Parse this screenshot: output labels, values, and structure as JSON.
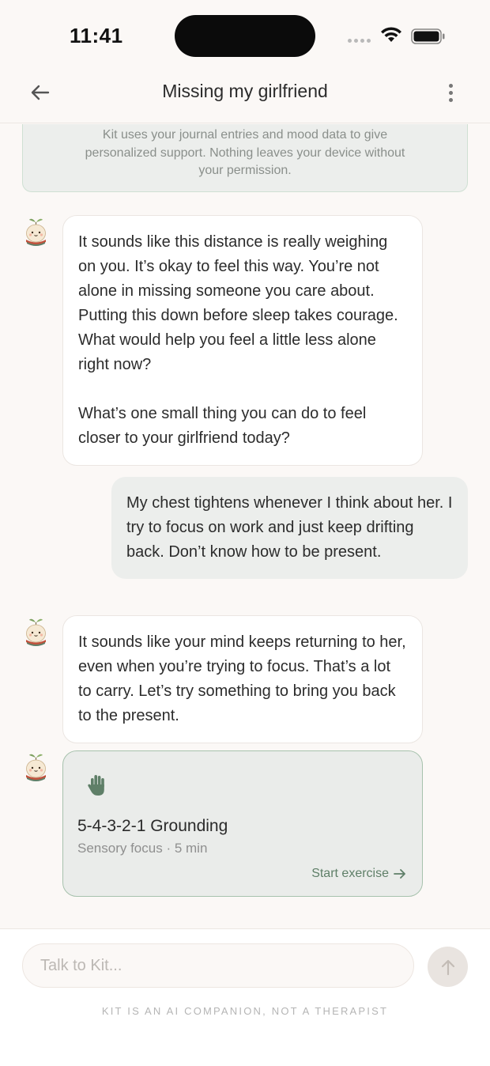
{
  "status_bar": {
    "time": "11:41"
  },
  "header": {
    "title": "Missing my girlfriend"
  },
  "notice": {
    "text": "Kit uses your journal entries and mood data to give personalized support. Nothing leaves your device without your permission."
  },
  "messages": [
    {
      "sender": "kit",
      "text": "It sounds like this distance is really weighing on you. It’s okay to feel this way. You’re not alone in missing someone you care about. Putting this down before sleep takes courage. What would help you feel a little less alone right now?\n\nWhat’s one small thing you can do to feel closer to your girlfriend today?"
    },
    {
      "sender": "user",
      "text": "My chest tightens whenever I think about her. I try to focus on work and just keep drifting back. Don’t know how to be present."
    },
    {
      "sender": "kit",
      "text": "It sounds like your mind keeps returning to her, even when you’re trying to focus. That’s a lot to carry. Let’s try something to bring you back to the present."
    }
  ],
  "exercise": {
    "icon": "hand-icon",
    "title": "5-4-3-2-1 Grounding",
    "subtitle": "Sensory focus · 5 min",
    "action": "Start exercise"
  },
  "composer": {
    "placeholder": "Talk to Kit...",
    "disclaimer": "KIT IS AN AI COMPANION, NOT A THERAPIST"
  },
  "colors": {
    "accent": "#5f7f68",
    "background": "#fbf8f6",
    "user_bubble": "#eceeec"
  }
}
